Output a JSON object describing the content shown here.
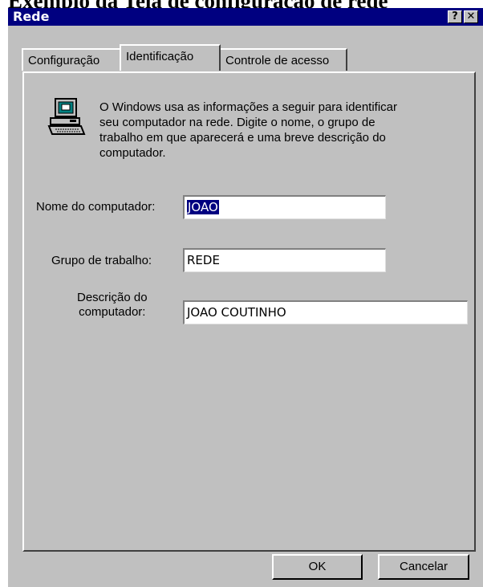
{
  "page_caption": "Exemplo da Tela de configuração de rede",
  "window": {
    "title": "Rede",
    "help_glyph": "?",
    "close_glyph": "✕"
  },
  "tabs": [
    {
      "label": "Configuração",
      "active": false
    },
    {
      "label": "Identificação",
      "active": true
    },
    {
      "label": "Controle de acesso",
      "active": false
    }
  ],
  "identification": {
    "description_line1": "O Windows usa as informações a seguir para identificar",
    "description_line2": "seu computador na rede. Digite o nome, o grupo de",
    "description_line3": "trabalho em que aparecerá e uma breve descrição do",
    "description_line4": "computador.",
    "icon": "network-computer-icon",
    "computer_name_label": "Nome do computador:",
    "computer_name_value": "JOAO",
    "workgroup_label": "Grupo de trabalho:",
    "workgroup_value": "REDE",
    "computer_description_label_line1": "Descrição do",
    "computer_description_label_line2": "computador:",
    "computer_description_value": "JOAO COUTINHO"
  },
  "buttons": {
    "ok": "OK",
    "cancel": "Cancelar"
  },
  "colors": {
    "titlebar": "#000080",
    "face": "#c0c0c0",
    "selection": "#000080"
  }
}
